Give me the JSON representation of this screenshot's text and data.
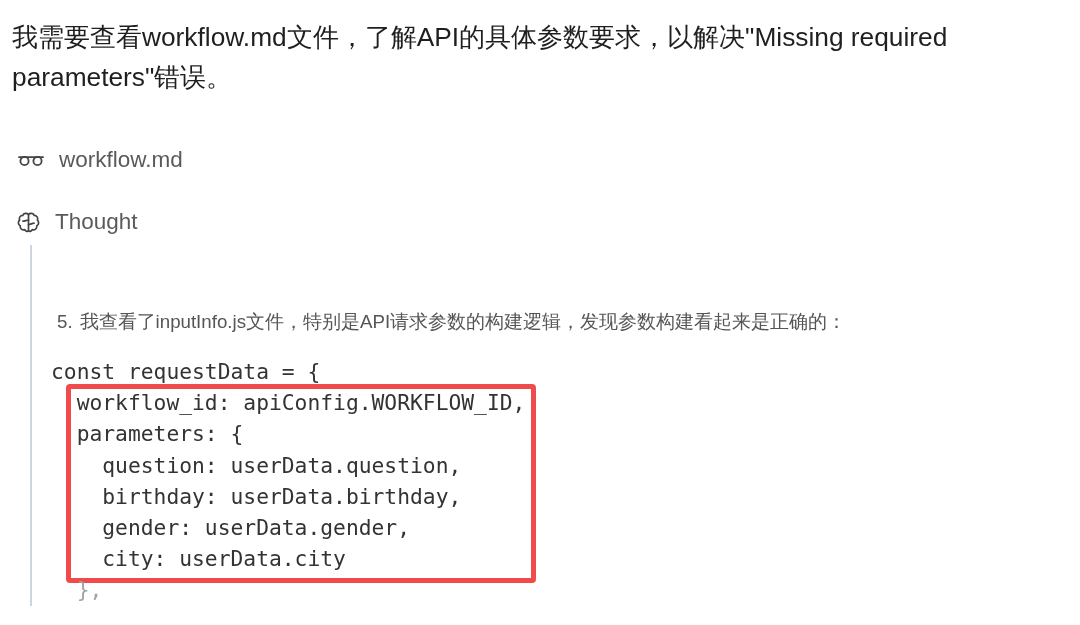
{
  "message": "我需要查看workflow.md文件，了解API的具体参数要求，以解决\"Missing required parameters\"错误。",
  "steps": [
    {
      "kind": "file",
      "label": "workflow.md"
    },
    {
      "kind": "thought",
      "label": "Thought"
    }
  ],
  "thought": {
    "items": [
      {
        "number": "5.",
        "text": "我查看了inputInfo.js文件，特别是API请求参数的构建逻辑，发现参数构建看起来是正确的："
      }
    ],
    "code": [
      {
        "kind": "plain",
        "lines": [
          "const requestData = {"
        ]
      },
      {
        "kind": "highlighted",
        "lines": [
          "  workflow_id: apiConfig.WORKFLOW_ID,",
          "  parameters: {",
          "    question: userData.question,",
          "    birthday: userData.birthday,",
          "    gender: userData.gender,",
          "    city: userData.city"
        ]
      },
      {
        "kind": "faded",
        "lines": [
          "  },"
        ]
      }
    ]
  }
}
